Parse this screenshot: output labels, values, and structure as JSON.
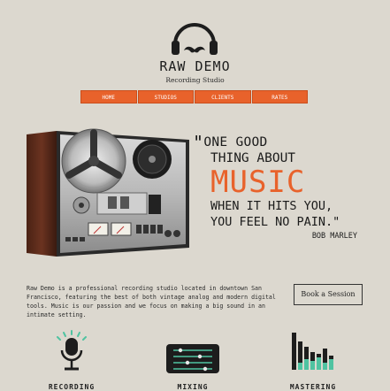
{
  "brand": {
    "title": "RAW DEMO",
    "subtitle": "Recording Studio"
  },
  "nav": {
    "items": [
      "HOME",
      "STUDIOS",
      "CLIENTS",
      "RATES"
    ]
  },
  "quote": {
    "line1": "ONE GOOD",
    "line2": "THING ABOUT",
    "line3": "MUSIC",
    "line4": "WHEN IT HITS YOU,",
    "line5": "YOU FEEL NO PAIN.\"",
    "author": "BOB MARLEY",
    "open_mark": "\""
  },
  "about": {
    "text": "Raw Demo is a professional recording studio located in downtown San Francisco, featuring the best of both vintage analog and modern digital tools. Music is our passion and we focus on making a big sound in an intimate setting."
  },
  "cta": {
    "book_label": "Book a Session"
  },
  "services": [
    {
      "label": "RECORDING",
      "icon": "microphone-icon"
    },
    {
      "label": "MIXING",
      "icon": "mixer-icon"
    },
    {
      "label": "MASTERING",
      "icon": "equalizer-icon"
    }
  ],
  "colors": {
    "background": "#dcd8cf",
    "accent": "#e8622b",
    "teal": "#4fc3a1",
    "dark": "#1d1d1d"
  }
}
